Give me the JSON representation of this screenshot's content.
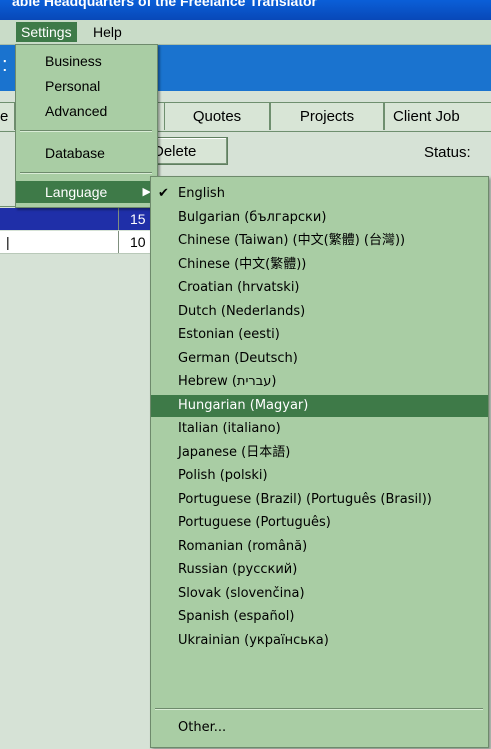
{
  "window": {
    "title": "able Headquarters of the Freelance Translator"
  },
  "menubar": {
    "settings": "Settings",
    "help": "Help"
  },
  "tabs": [
    "Quotes",
    "Projects",
    "Client Job"
  ],
  "tab_partial": "e",
  "toolbar": {
    "delete_label": "Delete",
    "status_label": "Status:"
  },
  "grid": {
    "rows": [
      {
        "value": "15"
      },
      {
        "value": "10"
      }
    ]
  },
  "settings_menu": {
    "items": [
      "Business",
      "Personal",
      "Advanced"
    ],
    "database": "Database",
    "language": "Language"
  },
  "language_menu": {
    "checked": "English",
    "selected": "Hungarian (Magyar)",
    "languages": [
      "English",
      "Bulgarian (български)",
      "Chinese (Taiwan) (中文(繁體) (台灣))",
      "Chinese (中文(繁體))",
      "Croatian (hrvatski)",
      "Dutch (Nederlands)",
      "Estonian (eesti)",
      "German (Deutsch)",
      "Hebrew (עברית)",
      "Hungarian (Magyar)",
      "Italian (italiano)",
      "Japanese (日本語)",
      "Polish (polski)",
      "Portuguese (Brazil) (Português (Brasil))",
      "Portuguese (Português)",
      "Romanian (română)",
      "Russian (русский)",
      "Slovak (slovenčina)",
      "Spanish (español)",
      "Ukrainian (українська)"
    ],
    "other": "Other..."
  },
  "icons": {
    "checkmark": "checkmark-icon",
    "submenu_arrow": "submenu-arrow-icon"
  },
  "colors": {
    "menu_bg": "#a9cda4",
    "highlight": "#3e7a48",
    "accent_blue": "#1a73cf"
  }
}
